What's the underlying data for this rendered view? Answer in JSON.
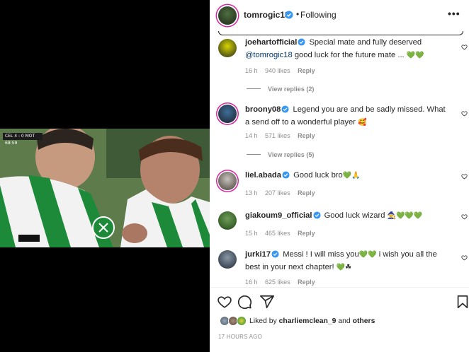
{
  "video": {
    "scoreboard": "CEL 4 : 0 MOT 68:59"
  },
  "header": {
    "username": "tomrogic18",
    "dot": "•",
    "following": "Following",
    "more": "•••"
  },
  "comments": [
    {
      "username": "joehartofficial",
      "text_a": "Special mate and fully deserved",
      "mention": "@tomrogic18",
      "text_b": "good luck for the future mate ...",
      "emoji": "💚💚",
      "time": "16 h",
      "likes": "940 likes",
      "reply": "Reply",
      "view_replies": "View replies (2)"
    },
    {
      "username": "broony08",
      "text_a": "Legend you are and be sadly missed. What a send off to a wonderful player",
      "emoji": "🥰",
      "time": "14 h",
      "likes": "571 likes",
      "reply": "Reply",
      "view_replies": "View replies (5)"
    },
    {
      "username": "liel.abada",
      "text_a": "Good luck bro",
      "emoji": "💚🙏",
      "time": "13 h",
      "likes": "207 likes",
      "reply": "Reply"
    },
    {
      "username": "giakoum9_official",
      "text_a": "Good luck wizard",
      "emoji": "🧙💚💚💚",
      "time": "15 h",
      "likes": "465 likes",
      "reply": "Reply"
    },
    {
      "username": "jurki17",
      "text_a": "Messi ! I will miss you",
      "emoji_a": "💚💚",
      "text_b": "i wish you all the best in your next chapter!",
      "emoji_b": "💚☘",
      "time": "16 h",
      "likes": "625 likes",
      "reply": "Reply"
    }
  ],
  "likes": {
    "prefix": "Liked by",
    "user": "charliemclean_9",
    "and": "and",
    "others": "others"
  },
  "timestamp": "17 HOURS AGO",
  "colors": {
    "verified": "#3897f0",
    "text": "#262626",
    "muted": "#8e8e8e",
    "mention": "#00376b",
    "story_ring": "#d6249f"
  },
  "icons": [
    "heart-icon",
    "comment-icon",
    "share-icon",
    "bookmark-icon",
    "more-icon",
    "verified-icon"
  ]
}
